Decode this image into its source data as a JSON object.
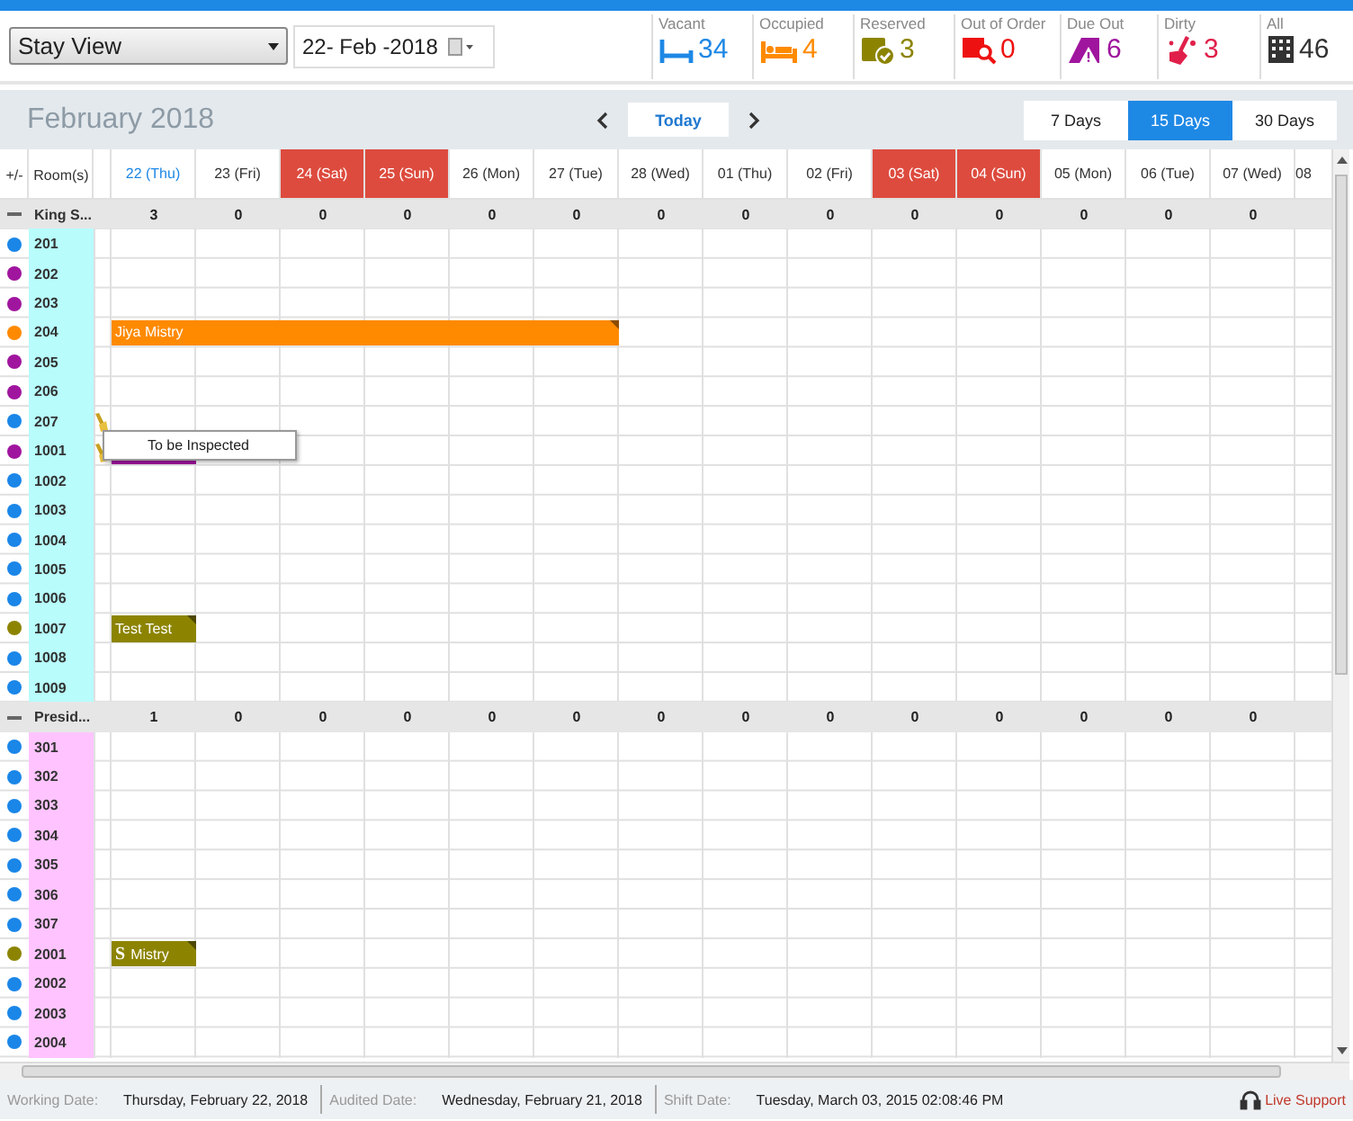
{
  "toolbar": {
    "view_select": "Stay View",
    "date": "22- Feb -2018"
  },
  "stats": [
    {
      "kind": "vacant",
      "label": "Vacant",
      "value": "34",
      "color": "#1e88e5"
    },
    {
      "kind": "occupied",
      "label": "Occupied",
      "value": "4",
      "color": "#ff8a00"
    },
    {
      "kind": "reserved",
      "label": "Reserved",
      "value": "3",
      "color": "#8c8400"
    },
    {
      "kind": "out_of_order",
      "label": "Out of Order",
      "value": "0",
      "color": "#ee1111"
    },
    {
      "kind": "due_out",
      "label": "Due Out",
      "value": "6",
      "color": "#a0159e"
    },
    {
      "kind": "dirty",
      "label": "Dirty",
      "value": "3",
      "color": "#e0204a"
    },
    {
      "kind": "all",
      "label": "All",
      "value": "46",
      "color": "#333333"
    }
  ],
  "calendar": {
    "title": "February 2018",
    "today_button": "Today",
    "ranges": [
      {
        "label": "7 Days",
        "selected": false
      },
      {
        "label": "15 Days",
        "selected": true
      },
      {
        "label": "30 Days",
        "selected": false
      }
    ]
  },
  "grid": {
    "toggle_header": "+/-",
    "room_header": "Room(s)",
    "days": [
      {
        "label": "22 (Thu)",
        "kind": "today"
      },
      {
        "label": "23 (Fri)",
        "kind": "normal"
      },
      {
        "label": "24 (Sat)",
        "kind": "weekend"
      },
      {
        "label": "25 (Sun)",
        "kind": "weekend"
      },
      {
        "label": "26 (Mon)",
        "kind": "normal"
      },
      {
        "label": "27 (Tue)",
        "kind": "normal"
      },
      {
        "label": "28 (Wed)",
        "kind": "normal"
      },
      {
        "label": "01 (Thu)",
        "kind": "normal"
      },
      {
        "label": "02 (Fri)",
        "kind": "normal"
      },
      {
        "label": "03 (Sat)",
        "kind": "weekend"
      },
      {
        "label": "04 (Sun)",
        "kind": "weekend"
      },
      {
        "label": "05 (Mon)",
        "kind": "normal"
      },
      {
        "label": "06 (Tue)",
        "kind": "normal"
      },
      {
        "label": "07 (Wed)",
        "kind": "normal"
      },
      {
        "label": "08",
        "kind": "partial"
      }
    ],
    "groups": [
      {
        "name": "King S...",
        "color": "#b8fcfc",
        "expanded": true,
        "counts": [
          "3",
          "0",
          "0",
          "0",
          "0",
          "0",
          "0",
          "0",
          "0",
          "0",
          "0",
          "0",
          "0",
          "0"
        ],
        "rooms": [
          {
            "name": "201",
            "color": "#1a86e8"
          },
          {
            "name": "202",
            "color": "#a0159e"
          },
          {
            "name": "203",
            "color": "#a0159e"
          },
          {
            "name": "204",
            "color": "#ff8a00",
            "booking": {
              "kind": "stay",
              "guest": "Jiya Mistry"
            }
          },
          {
            "name": "205",
            "color": "#a0159e"
          },
          {
            "name": "206",
            "color": "#a0159e"
          },
          {
            "name": "207",
            "color": "#1a86e8",
            "inspect": true
          },
          {
            "name": "1001",
            "color": "#a0159e",
            "inspect": true,
            "booking": {
              "kind": "stay"
            }
          },
          {
            "name": "1002",
            "color": "#1a86e8"
          },
          {
            "name": "1003",
            "color": "#1a86e8"
          },
          {
            "name": "1004",
            "color": "#1a86e8"
          },
          {
            "name": "1005",
            "color": "#1a86e8"
          },
          {
            "name": "1006",
            "color": "#1a86e8"
          },
          {
            "name": "1007",
            "color": "#8c8400",
            "booking": {
              "kind": "stay",
              "guest": "Test Test"
            }
          },
          {
            "name": "1008",
            "color": "#1a86e8"
          },
          {
            "name": "1009",
            "color": "#1a86e8"
          }
        ]
      },
      {
        "name": "Presid...",
        "color": "#ffc4ff",
        "expanded": true,
        "counts": [
          "1",
          "0",
          "0",
          "0",
          "0",
          "0",
          "0",
          "0",
          "0",
          "0",
          "0",
          "0",
          "0",
          "0"
        ],
        "rooms": [
          {
            "name": "301",
            "color": "#1a86e8"
          },
          {
            "name": "302",
            "color": "#1a86e8"
          },
          {
            "name": "303",
            "color": "#1a86e8"
          },
          {
            "name": "304",
            "color": "#1a86e8"
          },
          {
            "name": "305",
            "color": "#1a86e8"
          },
          {
            "name": "306",
            "color": "#1a86e8"
          },
          {
            "name": "307",
            "color": "#1a86e8"
          },
          {
            "name": "2001",
            "color": "#8c8400",
            "booking": {
              "kind": "stay",
              "badge": "S",
              "guest": "Mistry"
            }
          },
          {
            "name": "2002",
            "color": "#1a86e8"
          },
          {
            "name": "2003",
            "color": "#1a86e8"
          },
          {
            "name": "2004",
            "color": "#1a86e8"
          }
        ]
      }
    ]
  },
  "popup": {
    "text": "To be Inspected"
  },
  "status_bar": {
    "items": [
      {
        "label": "Working Date:",
        "value": "Thursday, February 22, 2018"
      },
      {
        "label": "Audited Date:",
        "value": "Wednesday, February 21, 2018"
      },
      {
        "label": "Shift Date:",
        "value": "Tuesday, March 03, 2015 02:08:46 PM"
      }
    ],
    "live_support": "Live Support"
  }
}
